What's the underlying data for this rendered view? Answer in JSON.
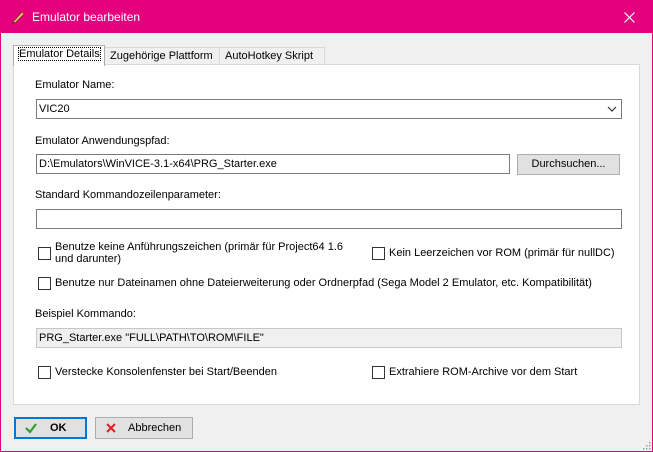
{
  "window": {
    "title": "Emulator bearbeiten",
    "accent_color": "#e5007e",
    "icon": "pencil-icon",
    "close_icon": "close-icon"
  },
  "tabs": [
    {
      "label": "Emulator Details",
      "active": true
    },
    {
      "label": "Zugehörige Plattform",
      "active": false
    },
    {
      "label": "AutoHotkey Skript",
      "active": false
    }
  ],
  "form": {
    "name_label": "Emulator Name:",
    "name_value": "VIC20",
    "path_label": "Emulator Anwendungspfad:",
    "path_value": "D:\\Emulators\\WinVICE-3.1-x64\\PRG_Starter.exe",
    "browse_label": "Durchsuchen...",
    "params_label": "Standard Kommandozeilenparameter:",
    "params_value": "",
    "chk_no_quotes_line1": "Benutze keine Anführungszeichen (primär für Project64 1.6",
    "chk_no_quotes_line2": "und darunter)",
    "chk_no_space": "Kein Leerzeichen vor ROM (primär für nullDC)",
    "chk_filename_only": "Benutze nur Dateinamen ohne Dateierweiterung oder Ordnerpfad (Sega Model 2 Emulator, etc. Kompatibilität)",
    "example_label": "Beispiel Kommando:",
    "example_value": "PRG_Starter.exe \"FULL\\PATH\\TO\\ROM\\FILE\"",
    "chk_hide_console": "Verstecke Konsolenfenster bei Start/Beenden",
    "chk_extract_rom": "Extrahiere ROM-Archive vor dem Start",
    "checked": {
      "no_quotes": false,
      "no_space": false,
      "filename_only": false,
      "hide_console": false,
      "extract_rom": false
    }
  },
  "buttons": {
    "ok_label": "OK",
    "ok_icon": "checkmark-icon",
    "cancel_label": "Abbrechen",
    "cancel_icon": "x-icon"
  }
}
